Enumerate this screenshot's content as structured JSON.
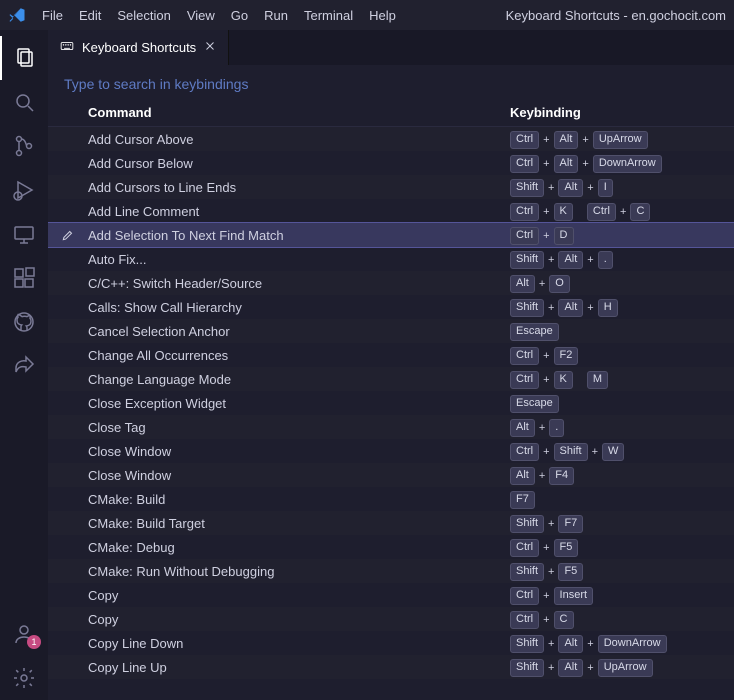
{
  "titlebar": {
    "menus": [
      "File",
      "Edit",
      "Selection",
      "View",
      "Go",
      "Run",
      "Terminal",
      "Help"
    ],
    "window_title": "Keyboard Shortcuts - en.gochocit.com"
  },
  "tab": {
    "label": "Keyboard Shortcuts"
  },
  "search": {
    "placeholder": "Type to search in keybindings"
  },
  "columns": {
    "command": "Command",
    "keybinding": "Keybinding"
  },
  "accounts_badge": "1",
  "selected_index": 4,
  "rows": [
    {
      "command": "Add Cursor Above",
      "chords": [
        [
          "Ctrl",
          "Alt",
          "UpArrow"
        ]
      ]
    },
    {
      "command": "Add Cursor Below",
      "chords": [
        [
          "Ctrl",
          "Alt",
          "DownArrow"
        ]
      ]
    },
    {
      "command": "Add Cursors to Line Ends",
      "chords": [
        [
          "Shift",
          "Alt",
          "I"
        ]
      ]
    },
    {
      "command": "Add Line Comment",
      "chords": [
        [
          "Ctrl",
          "K"
        ],
        [
          "Ctrl",
          "C"
        ]
      ]
    },
    {
      "command": "Add Selection To Next Find Match",
      "chords": [
        [
          "Ctrl",
          "D"
        ]
      ]
    },
    {
      "command": "Auto Fix...",
      "chords": [
        [
          "Shift",
          "Alt",
          "."
        ]
      ]
    },
    {
      "command": "C/C++: Switch Header/Source",
      "chords": [
        [
          "Alt",
          "O"
        ]
      ]
    },
    {
      "command": "Calls: Show Call Hierarchy",
      "chords": [
        [
          "Shift",
          "Alt",
          "H"
        ]
      ]
    },
    {
      "command": "Cancel Selection Anchor",
      "chords": [
        [
          "Escape"
        ]
      ]
    },
    {
      "command": "Change All Occurrences",
      "chords": [
        [
          "Ctrl",
          "F2"
        ]
      ]
    },
    {
      "command": "Change Language Mode",
      "chords": [
        [
          "Ctrl",
          "K"
        ],
        [
          "M"
        ]
      ]
    },
    {
      "command": "Close Exception Widget",
      "chords": [
        [
          "Escape"
        ]
      ]
    },
    {
      "command": "Close Tag",
      "chords": [
        [
          "Alt",
          "."
        ]
      ]
    },
    {
      "command": "Close Window",
      "chords": [
        [
          "Ctrl",
          "Shift",
          "W"
        ]
      ]
    },
    {
      "command": "Close Window",
      "chords": [
        [
          "Alt",
          "F4"
        ]
      ]
    },
    {
      "command": "CMake: Build",
      "chords": [
        [
          "F7"
        ]
      ]
    },
    {
      "command": "CMake: Build Target",
      "chords": [
        [
          "Shift",
          "F7"
        ]
      ]
    },
    {
      "command": "CMake: Debug",
      "chords": [
        [
          "Ctrl",
          "F5"
        ]
      ]
    },
    {
      "command": "CMake: Run Without Debugging",
      "chords": [
        [
          "Shift",
          "F5"
        ]
      ]
    },
    {
      "command": "Copy",
      "chords": [
        [
          "Ctrl",
          "Insert"
        ]
      ]
    },
    {
      "command": "Copy",
      "chords": [
        [
          "Ctrl",
          "C"
        ]
      ]
    },
    {
      "command": "Copy Line Down",
      "chords": [
        [
          "Shift",
          "Alt",
          "DownArrow"
        ]
      ]
    },
    {
      "command": "Copy Line Up",
      "chords": [
        [
          "Shift",
          "Alt",
          "UpArrow"
        ]
      ]
    }
  ]
}
